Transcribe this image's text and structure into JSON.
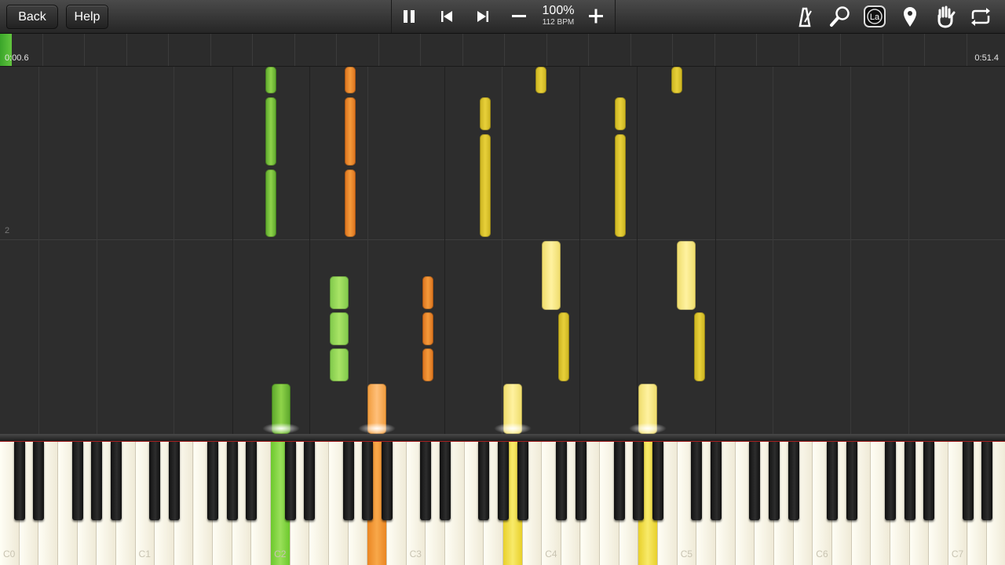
{
  "toolbar": {
    "back_label": "Back",
    "help_label": "Help",
    "speed_percent": "100%",
    "tempo": "112 BPM",
    "icons": [
      "pause-icon",
      "skip-previous-icon",
      "skip-next-icon",
      "minus-icon",
      "plus-icon",
      "metronome-icon",
      "zoom-icon",
      "note-labels-icon",
      "location-pin-icon",
      "hand-icon",
      "loop-icon"
    ],
    "note_labels_text": "La"
  },
  "timeline": {
    "time_elapsed": "0:00.6",
    "time_total": "0:51.4",
    "progress": 0.012
  },
  "roll": {
    "measure_label": "2"
  },
  "keyboard": {
    "octave_labels": [
      "C0",
      "C1",
      "C2",
      "C3",
      "C4",
      "C5",
      "C6",
      "C7"
    ],
    "active_colors": {
      "green": "#7ed63c",
      "orange": "#f2922a",
      "yellow": "#ead64a"
    }
  }
}
